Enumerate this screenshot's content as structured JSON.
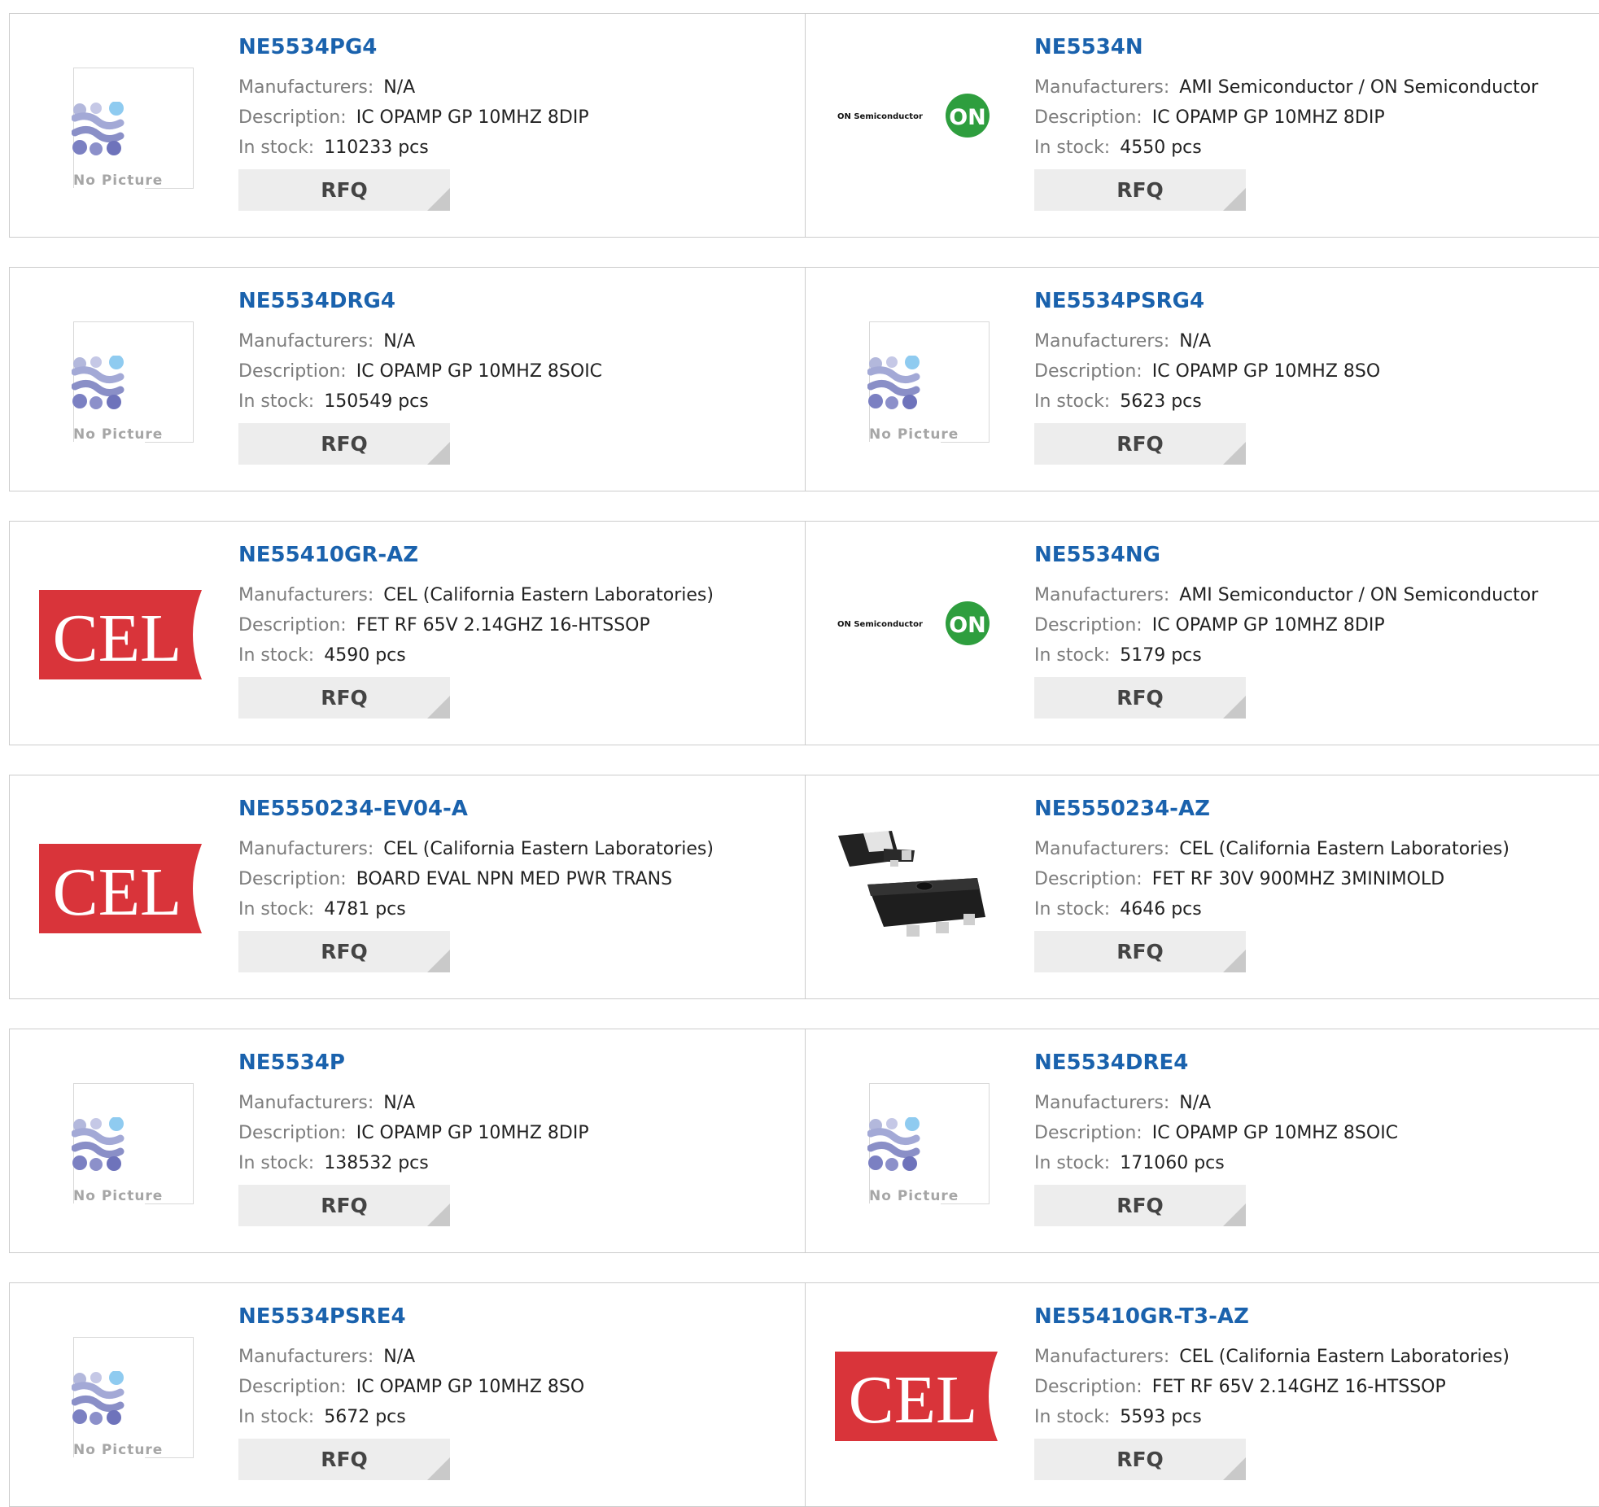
{
  "labels": {
    "manufacturers": "Manufacturers:",
    "description": "Description:",
    "in_stock": "In stock:",
    "rfq": "RFQ",
    "no_picture": "No Picture"
  },
  "logo_text": {
    "cel": "CEL",
    "on_semi": "ON Semiconductor",
    "on_mark": "ON"
  },
  "colors": {
    "part_link": "#1a62ad",
    "cel_red": "#d9343a",
    "on_green": "#2e9e3e",
    "rfq_bg": "#ededed"
  },
  "products": [
    {
      "part": "NE5534PG4",
      "manufacturer": "N/A",
      "description": "IC OPAMP GP 10MHZ 8DIP",
      "stock": "110233 pcs",
      "image": "no-picture"
    },
    {
      "part": "NE5534N",
      "manufacturer": "AMI Semiconductor / ON Semiconductor",
      "description": "IC OPAMP GP 10MHZ 8DIP",
      "stock": "4550 pcs",
      "image": "on-semi-logo"
    },
    {
      "part": "NE5534DRG4",
      "manufacturer": "N/A",
      "description": "IC OPAMP GP 10MHZ 8SOIC",
      "stock": "150549 pcs",
      "image": "no-picture"
    },
    {
      "part": "NE5534PSRG4",
      "manufacturer": "N/A",
      "description": "IC OPAMP GP 10MHZ 8SO",
      "stock": "5623 pcs",
      "image": "no-picture"
    },
    {
      "part": "NE55410GR-AZ",
      "manufacturer": "CEL (California Eastern Laboratories)",
      "description": "FET RF 65V 2.14GHZ 16-HTSSOP",
      "stock": "4590 pcs",
      "image": "cel-logo"
    },
    {
      "part": "NE5534NG",
      "manufacturer": "AMI Semiconductor / ON Semiconductor",
      "description": "IC OPAMP GP 10MHZ 8DIP",
      "stock": "5179 pcs",
      "image": "on-semi-logo"
    },
    {
      "part": "NE5550234-EV04-A",
      "manufacturer": "CEL (California Eastern Laboratories)",
      "description": "BOARD EVAL NPN MED PWR TRANS",
      "stock": "4781 pcs",
      "image": "cel-logo"
    },
    {
      "part": "NE5550234-AZ",
      "manufacturer": "CEL (California Eastern Laboratories)",
      "description": "FET RF 30V 900MHZ 3MINIMOLD",
      "stock": "4646 pcs",
      "image": "transistor-photo"
    },
    {
      "part": "NE5534P",
      "manufacturer": "N/A",
      "description": "IC OPAMP GP 10MHZ 8DIP",
      "stock": "138532 pcs",
      "image": "no-picture"
    },
    {
      "part": "NE5534DRE4",
      "manufacturer": "N/A",
      "description": "IC OPAMP GP 10MHZ 8SOIC",
      "stock": "171060 pcs",
      "image": "no-picture"
    },
    {
      "part": "NE5534PSRE4",
      "manufacturer": "N/A",
      "description": "IC OPAMP GP 10MHZ 8SO",
      "stock": "5672 pcs",
      "image": "no-picture"
    },
    {
      "part": "NE55410GR-T3-AZ",
      "manufacturer": "CEL (California Eastern Laboratories)",
      "description": "FET RF 65V 2.14GHZ 16-HTSSOP",
      "stock": "5593 pcs",
      "image": "cel-logo"
    }
  ]
}
